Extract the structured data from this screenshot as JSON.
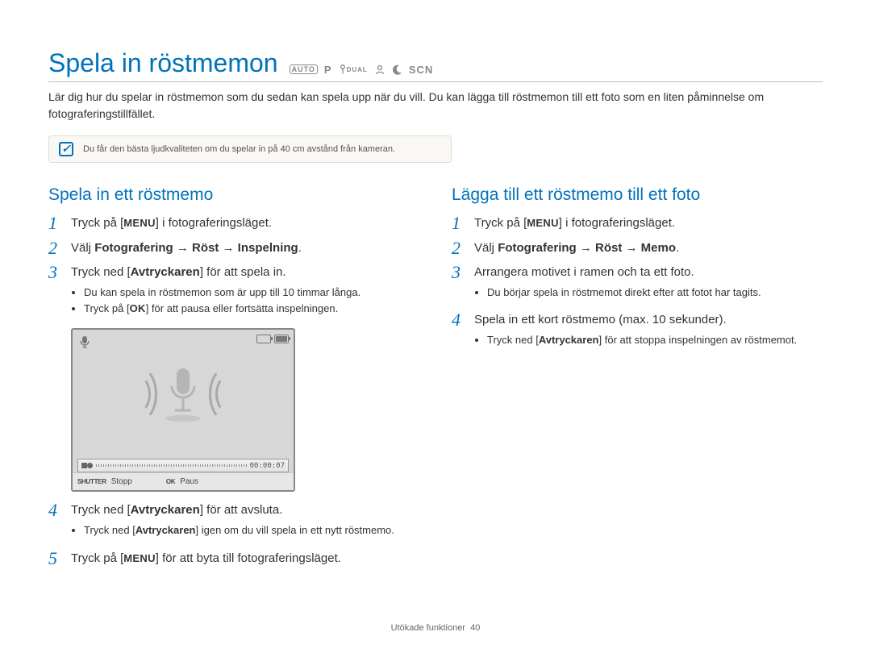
{
  "page": {
    "title": "Spela in röstmemon",
    "mode_icons": {
      "auto": "AUTO",
      "p": "P",
      "dual": "DUAL",
      "scene_guide": "",
      "night": "",
      "scn": "SCN"
    },
    "intro": "Lär dig hur du spelar in röstmemon som du sedan kan spela upp när du vill. Du kan lägga till röstmemon till ett foto som en liten påminnelse om fotograferingstillfället.",
    "tip": "Du får den bästa ljudkvaliteten om du spelar in på 40 cm avstånd från kameran.",
    "footer_section": "Utökade funktioner",
    "footer_page": "40"
  },
  "left": {
    "heading": "Spela in ett röstmemo",
    "steps": {
      "s1": {
        "pre": "Tryck på [",
        "label": "MENU",
        "post": "] i fotograferingsläget."
      },
      "s2": {
        "pre": "Välj ",
        "bold": "Fotografering → Röst → Inspelning",
        "post": "."
      },
      "s3": {
        "pre": "Tryck ned [",
        "label": "Avtryckaren",
        "post": "] för att spela in.",
        "bullets": [
          "Du kan spela in röstmemon som är upp till 10 timmar långa.",
          {
            "pre": "Tryck på [",
            "label": "OK",
            "post": "] för att pausa eller fortsätta inspelningen."
          }
        ]
      },
      "s4": {
        "pre": "Tryck ned [",
        "label": "Avtryckaren",
        "post": "] för att avsluta.",
        "bullets": [
          {
            "pre": "Tryck ned [",
            "label": "Avtryckaren",
            "post": "] igen om du vill spela in ett nytt röstmemo."
          }
        ]
      },
      "s5": {
        "pre": "Tryck på [",
        "label": "MENU",
        "post": "] för att byta till fotograferingsläget."
      }
    },
    "camera": {
      "time": "00:00:07",
      "shutter_label": "SHUTTER",
      "shutter_text": "Stopp",
      "ok_label": "OK",
      "ok_text": "Paus"
    }
  },
  "right": {
    "heading": "Lägga till ett röstmemo till ett foto",
    "steps": {
      "s1": {
        "pre": "Tryck på [",
        "label": "MENU",
        "post": "] i fotograferingsläget."
      },
      "s2": {
        "pre": "Välj ",
        "bold": "Fotografering → Röst → Memo",
        "post": "."
      },
      "s3": {
        "text": "Arrangera motivet i ramen och ta ett foto.",
        "bullets": [
          "Du börjar spela in röstmemot direkt efter att fotot har tagits."
        ]
      },
      "s4": {
        "text": "Spela in ett kort röstmemo (max. 10 sekunder).",
        "bullets": [
          {
            "pre": "Tryck ned [",
            "label": "Avtryckaren",
            "post": "] för att stoppa inspelningen av röstmemot."
          }
        ]
      }
    }
  }
}
